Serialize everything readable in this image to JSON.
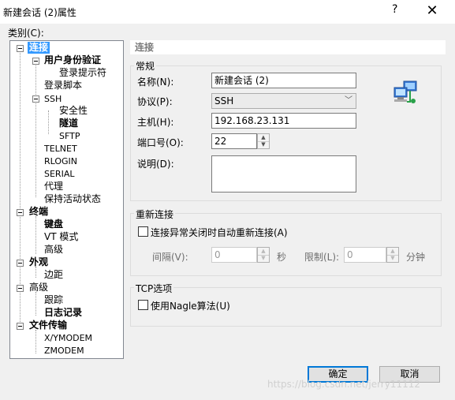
{
  "window": {
    "title": "新建会话 (2)属性",
    "help": "?",
    "close": "✕"
  },
  "category_label": "类别(C):",
  "tree": {
    "connection": "连接",
    "user_auth": "用户身份验证",
    "login_prompt": "登录提示符",
    "login_script": "登录脚本",
    "ssh": "SSH",
    "security": "安全性",
    "tunnel": "隧道",
    "sftp": "SFTP",
    "telnet": "TELNET",
    "rlogin": "RLOGIN",
    "serial": "SERIAL",
    "proxy": "代理",
    "keepalive": "保持活动状态",
    "terminal": "终端",
    "keyboard": "键盘",
    "vt_mode": "VT 模式",
    "advanced": "高级",
    "appearance": "外观",
    "margin": "边距",
    "advanced2": "高级",
    "trace": "跟踪",
    "logging": "日志记录",
    "file_transfer": "文件传输",
    "xymodem": "X/YMODEM",
    "zmodem": "ZMODEM"
  },
  "panel": {
    "header": "连接",
    "general": {
      "title": "常规",
      "name_label": "名称(N):",
      "name_value": "新建会话 (2)",
      "protocol_label": "协议(P):",
      "protocol_value": "SSH",
      "host_label": "主机(H):",
      "host_value": "192.168.23.131",
      "port_label": "端口号(O):",
      "port_value": "22",
      "desc_label": "说明(D):",
      "desc_value": ""
    },
    "reconnect": {
      "title": "重新连接",
      "auto_label": "连接异常关闭时自动重新连接(A)",
      "interval_label": "间隔(V):",
      "interval_value": "0",
      "sec_label": "秒",
      "limit_label": "限制(L):",
      "limit_value": "0",
      "min_label": "分钟"
    },
    "tcp": {
      "title": "TCP选项",
      "nagle_label": "使用Nagle算法(U)"
    }
  },
  "buttons": {
    "ok": "确定",
    "cancel": "取消"
  },
  "watermark": "https://blog.csdn.net/jerry11112"
}
